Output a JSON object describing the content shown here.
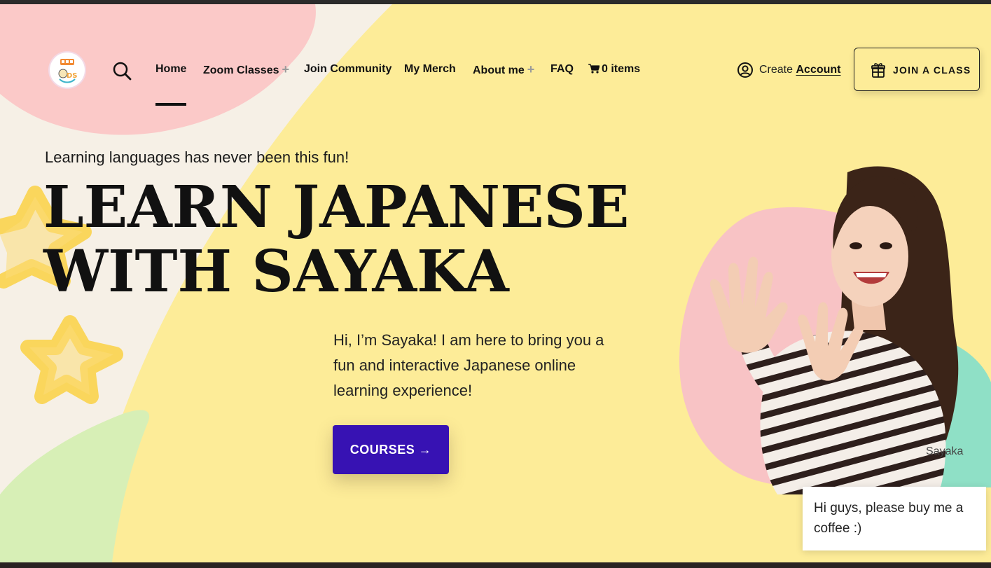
{
  "header": {
    "logo_alt": "site-logo",
    "nav": [
      {
        "label": "Home",
        "has_submenu": false,
        "active": true
      },
      {
        "label": "Zoom Classes",
        "has_submenu": true
      },
      {
        "label": "Join Community",
        "has_submenu": false
      },
      {
        "label": "My Merch",
        "has_submenu": false
      },
      {
        "label": "About me",
        "has_submenu": true
      },
      {
        "label": "FAQ",
        "has_submenu": false
      },
      {
        "label": "0 items",
        "has_submenu": false,
        "icon": "cart-icon"
      }
    ],
    "submenu_glyph": "+",
    "account": {
      "prefix": "Create",
      "link": "Account",
      "icon": "user-circle-icon"
    },
    "join_button": {
      "label": "JOIN A CLASS",
      "icon": "gift-icon"
    }
  },
  "hero": {
    "tagline": "Learning languages has never been this fun!",
    "headline_line1": "LEARN JAPANESE",
    "headline_line2": "WITH SAYAKA",
    "intro": "Hi, I’m Sayaka! I am here to bring you a fun and interactive Japanese online learning experience!",
    "cta_label": "COURSES →",
    "photo_caption": "Sayaka"
  },
  "chat": {
    "message": "Hi guys, please buy me a coffee :)"
  },
  "colors": {
    "background": "#fdec98",
    "cta": "#3712b3",
    "pink_blob": "#f8c3c5",
    "teal_blob": "#8fe0c6",
    "green_blob": "#d4efb0",
    "star": "#fad65c"
  }
}
